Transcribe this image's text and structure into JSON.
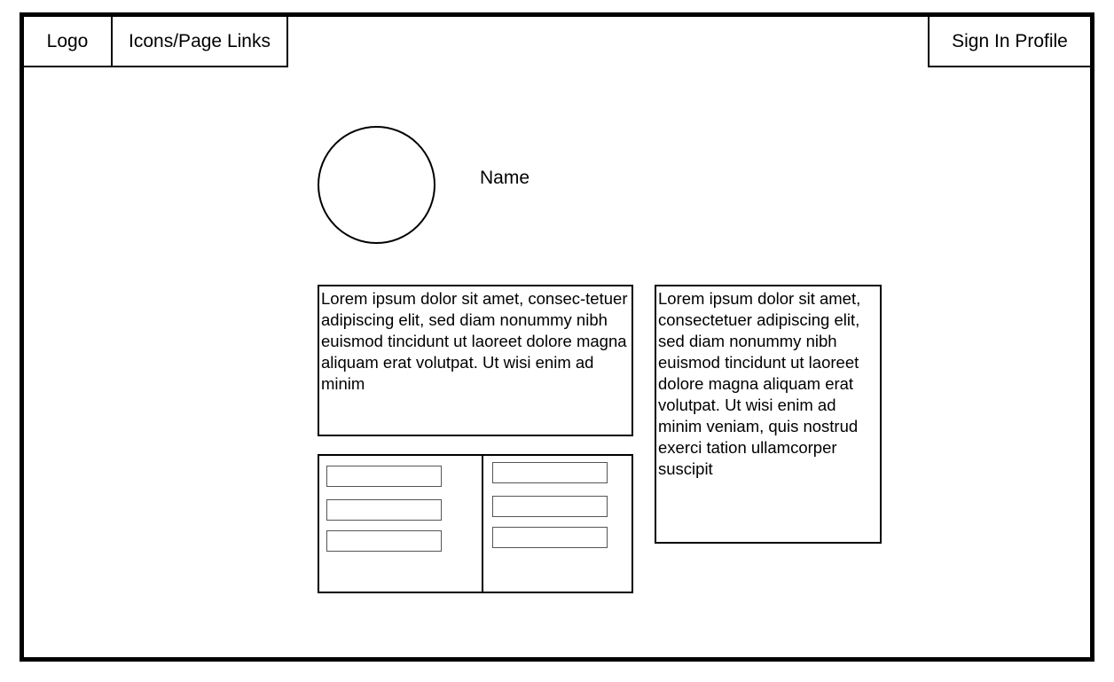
{
  "header": {
    "logo": "Logo",
    "page_links": "Icons/Page Links",
    "sign_in": "Sign In Profile"
  },
  "profile": {
    "name": "Name"
  },
  "cards": {
    "left_text": "Lorem ipsum dolor sit amet, consec-tetuer adipiscing elit, sed diam nonummy nibh euismod tincidunt ut laoreet dolore magna aliquam erat volutpat. Ut wisi enim ad minim",
    "right_text": "Lorem ipsum dolor sit amet, consectetuer adipiscing elit, sed diam nonummy nibh euismod tincidunt ut laoreet dolore magna aliquam erat volutpat. Ut wisi enim ad minim veniam, quis nostrud exerci tation ullamcorper suscipit"
  },
  "form": {
    "left_fields": [
      "",
      "",
      ""
    ],
    "right_fields": [
      "",
      "",
      ""
    ]
  }
}
